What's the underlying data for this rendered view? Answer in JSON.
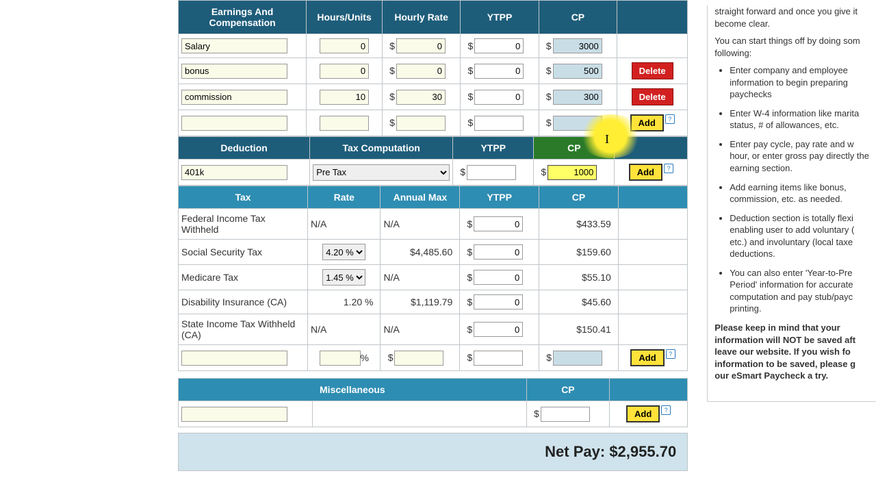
{
  "earnings": {
    "headers": {
      "name": "Earnings And Compensation",
      "hours": "Hours/Units",
      "rate": "Hourly Rate",
      "ytpp": "YTPP",
      "cp": "CP"
    },
    "rows": [
      {
        "name": "Salary",
        "hours": "0",
        "rate": "0",
        "ytpp": "0",
        "cp": "3000",
        "action": ""
      },
      {
        "name": "bonus",
        "hours": "0",
        "rate": "0",
        "ytpp": "0",
        "cp": "500",
        "action": "Delete"
      },
      {
        "name": "commission",
        "hours": "10",
        "rate": "30",
        "ytpp": "0",
        "cp": "300",
        "action": "Delete"
      }
    ],
    "add": {
      "label": "Add"
    }
  },
  "deduction": {
    "headers": {
      "name": "Deduction",
      "tax": "Tax Computation",
      "ytpp": "YTPP",
      "cp": "CP"
    },
    "row": {
      "name": "401k",
      "tax": "Pre Tax",
      "ytpp": "",
      "cp": "1000"
    },
    "add": {
      "label": "Add"
    }
  },
  "tax": {
    "headers": {
      "name": "Tax",
      "rate": "Rate",
      "max": "Annual Max",
      "ytpp": "YTPP",
      "cp": "CP"
    },
    "rows": [
      {
        "name": "Federal Income Tax Withheld",
        "rate": "N/A",
        "max": "N/A",
        "ytpp": "0",
        "cp": "$433.59"
      },
      {
        "name": "Social Security Tax",
        "rate": "4.20 %",
        "max": "$4,485.60",
        "ytpp": "0",
        "cp": "$159.60"
      },
      {
        "name": "Medicare Tax",
        "rate": "1.45 %",
        "max": "N/A",
        "ytpp": "0",
        "cp": "$55.10"
      },
      {
        "name": "Disability Insurance (CA)",
        "rate": "1.20 %",
        "max": "$1,119.79",
        "ytpp": "0",
        "cp": "$45.60"
      },
      {
        "name": "State Income Tax Withheld (CA)",
        "rate": "N/A",
        "max": "N/A",
        "ytpp": "0",
        "cp": "$150.41"
      }
    ],
    "add": {
      "label": "Add",
      "pct": "%"
    }
  },
  "misc": {
    "headers": {
      "name": "Miscellaneous",
      "cp": "CP"
    },
    "add": {
      "label": "Add"
    }
  },
  "netpay": {
    "label": "Net Pay:",
    "value": "$2,955.70"
  },
  "side": {
    "p0a": "straight forward and once you give it",
    "p0b": "become clear.",
    "p1a": "You can start things off by doing som",
    "p1b": "following:",
    "bullets": [
      "Enter company and employee information to begin preparing paychecks",
      "Enter W-4 information like marita status, # of allowances, etc.",
      "Enter pay cycle, pay rate and w hour, or enter gross pay directly the earning section.",
      "Add earning items like bonus, commission, etc. as needed.",
      "Deduction section is totally flexi enabling user to add voluntary ( etc.) and involuntary (local taxe deductions.",
      "You can also enter 'Year-to-Pre Period' information for accurate computation and pay stub/payc printing."
    ],
    "p2": "Please keep in mind that your information will NOT be saved aft leave our website. If you wish fo information to be saved, please g our eSmart Paycheck a try."
  }
}
